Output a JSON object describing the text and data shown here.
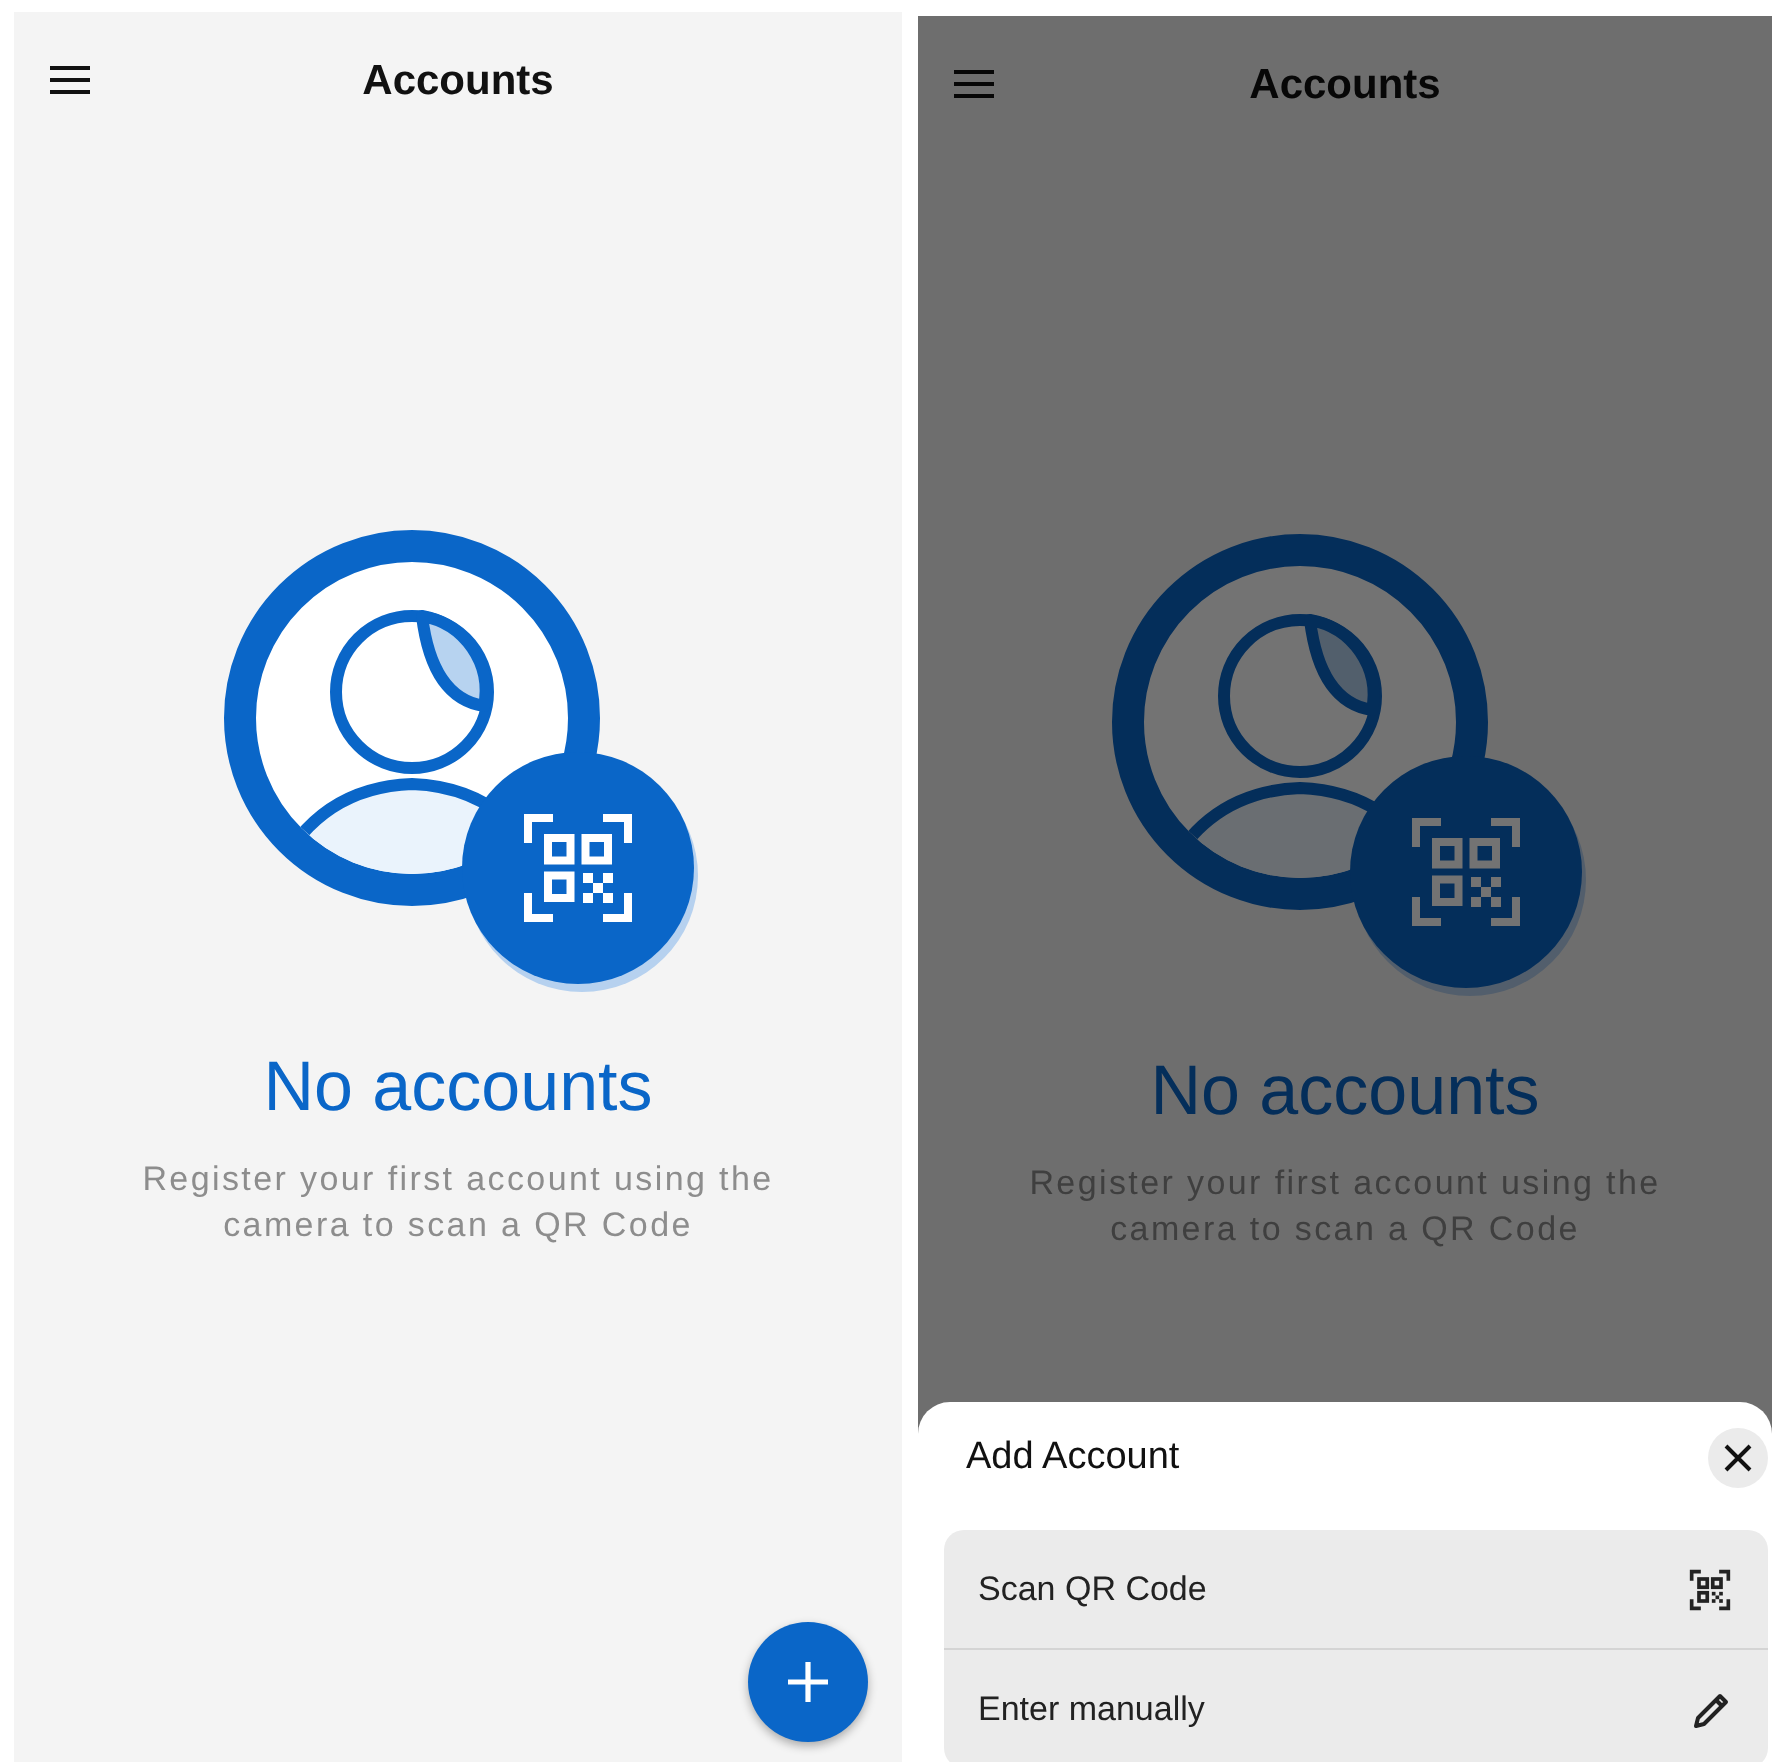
{
  "screens": [
    {
      "title": "Accounts",
      "dimmed": false,
      "empty_title": "No accounts",
      "empty_text": "Register your first account using the camera to scan a QR Code",
      "fab": true
    },
    {
      "title": "Accounts",
      "dimmed": true,
      "empty_title": "No accounts",
      "empty_text": "Register your first account using the camera to scan a QR Code",
      "fab": false,
      "sheet": {
        "title": "Add Account",
        "options": [
          {
            "label": "Scan QR Code",
            "kind": "qr"
          },
          {
            "label": "Enter manually",
            "kind": "edit"
          }
        ]
      }
    }
  ]
}
